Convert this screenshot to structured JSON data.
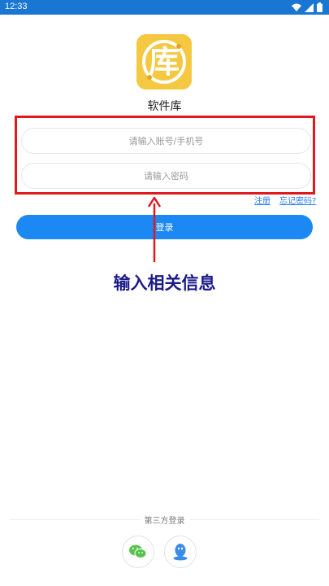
{
  "status_bar": {
    "time": "12:33",
    "icons": [
      "wifi-icon",
      "signal-icon",
      "battery-icon"
    ]
  },
  "app": {
    "name": "软件库",
    "logo_char": "库",
    "logo_color": "#f5c842"
  },
  "form": {
    "account_placeholder": "请输入账号/手机号",
    "password_placeholder": "请输入密码",
    "register_label": "注册",
    "forgot_label": "忘记密码?",
    "login_label": "登录"
  },
  "annotation": {
    "text": "输入相关信息",
    "color": "#1a1a8a",
    "box_color": "#e0191f"
  },
  "third_party": {
    "label": "第三方登录",
    "options": [
      "wechat-icon",
      "qq-icon"
    ]
  },
  "colors": {
    "accent": "#1c88f4",
    "status_bar": "#1976d2"
  }
}
